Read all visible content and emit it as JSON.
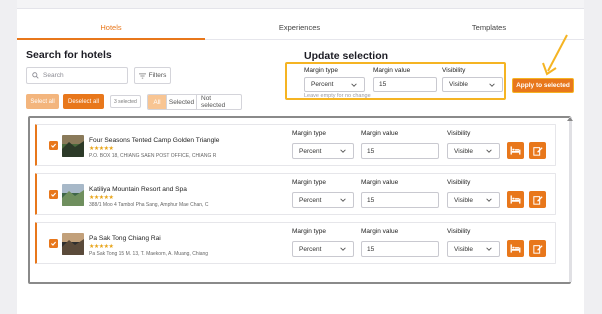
{
  "tabs": [
    {
      "label": "Hotels",
      "active": true
    },
    {
      "label": "Experiences",
      "active": false
    },
    {
      "label": "Templates",
      "active": false
    }
  ],
  "search": {
    "heading": "Search for hotels",
    "placeholder": "Search",
    "filters_label": "Filters",
    "select_all": "Select all",
    "deselect_all": "Deselect all",
    "selected_count": "3 selected",
    "segments": [
      "All",
      "Selected",
      "Not selected"
    ]
  },
  "update": {
    "heading": "Update selection",
    "margin_type_label": "Margin type",
    "margin_type_value": "Percent",
    "margin_value_label": "Margin value",
    "margin_value": "15",
    "visibility_label": "Visibility",
    "visibility_value": "Visible",
    "hint": "Leave empty for no change",
    "apply_label": "Apply to selected"
  },
  "rows": [
    {
      "name": "Four Seasons Tented Camp Golden Triangle",
      "stars": "★★★★★",
      "address": "P.O. BOX 18, CHIANG SAEN POST OFFICE, CHIANG R",
      "margin_type_label": "Margin type",
      "margin_type": "Percent",
      "margin_value_label": "Margin value",
      "margin_value": "15",
      "visibility_label": "Visibility",
      "visibility": "Visible"
    },
    {
      "name": "Katiliya Mountain Resort and Spa",
      "stars": "★★★★★",
      "address": "388/1 Moo 4 Tambol Pha Sang, Amphur Mae Chan, C",
      "margin_type_label": "Margin type",
      "margin_type": "Percent",
      "margin_value_label": "Margin value",
      "margin_value": "15",
      "visibility_label": "Visibility",
      "visibility": "Visible"
    },
    {
      "name": "Pa Sak Tong Chiang Rai",
      "stars": "★★★★★",
      "address": "Pa Sak Tong 15 M. 13, T. Maekorn, A. Muang, Chiang",
      "margin_type_label": "Margin type",
      "margin_type": "Percent",
      "margin_value_label": "Margin value",
      "margin_value": "15",
      "visibility_label": "Visibility",
      "visibility": "Visible"
    }
  ],
  "colors": {
    "accent": "#e8771b",
    "highlight": "#f5b423",
    "frame": "#8a8a8a"
  },
  "icons": [
    "search-icon",
    "filter-icon",
    "chevron-down-icon",
    "bed-icon",
    "edit-icon",
    "checkbox-icon",
    "arrow-icon"
  ]
}
